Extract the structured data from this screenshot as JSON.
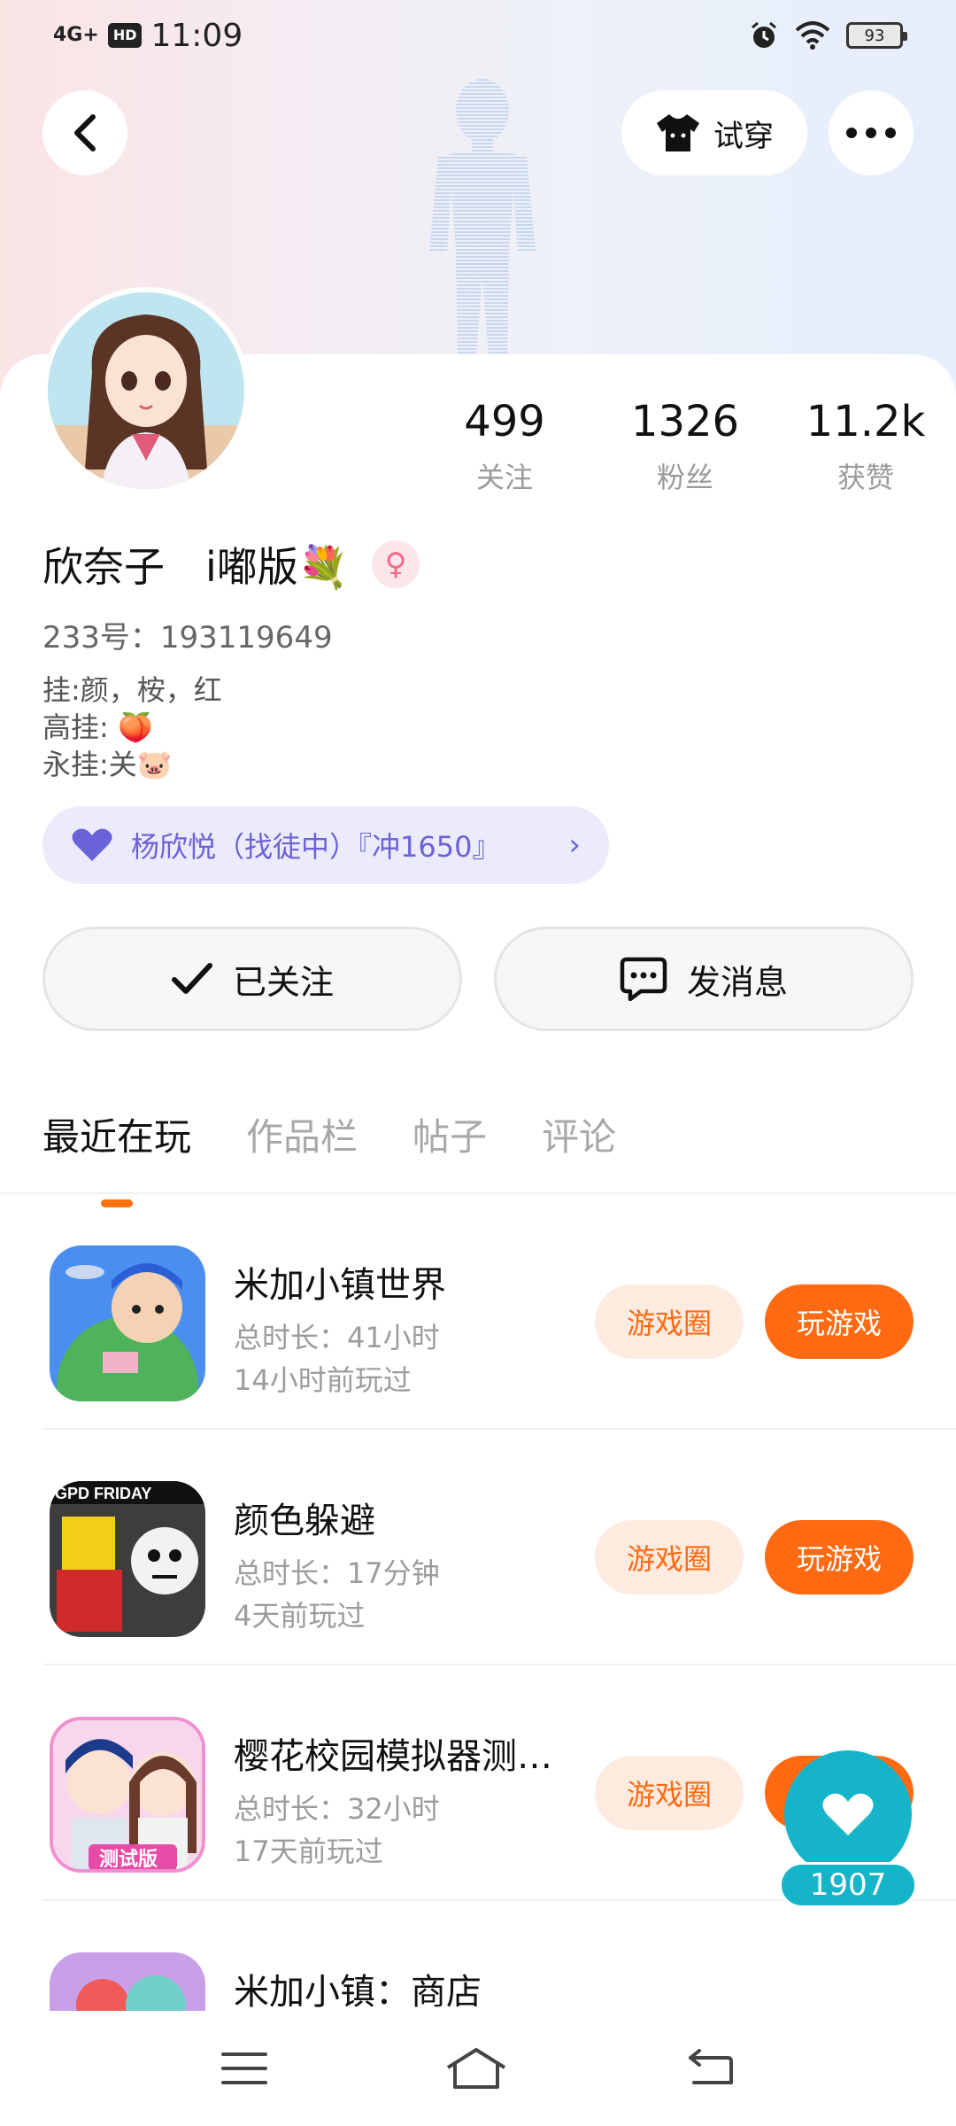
{
  "status_bar": {
    "network": "4G+",
    "hd": "HD",
    "time": "11:09",
    "battery": "93"
  },
  "header": {
    "try_on_label": "试穿"
  },
  "profile": {
    "stats": [
      {
        "value": "499",
        "label": "关注"
      },
      {
        "value": "1326",
        "label": "粉丝"
      },
      {
        "value": "11.2k",
        "label": "获赞"
      }
    ],
    "name": "欣奈子　i嘟版💐",
    "gender_symbol": "♀",
    "uid": "233号：193119649",
    "bio_lines": [
      "挂:颜，桉，红",
      "高挂: 🍑",
      "永挂:关🐷"
    ],
    "guild_text": "杨欣悦（找徒中）『冲1650』",
    "follow_label": "已关注",
    "message_label": "发消息"
  },
  "tabs": [
    {
      "label": "最近在玩",
      "active": true
    },
    {
      "label": "作品栏",
      "active": false
    },
    {
      "label": "帖子",
      "active": false
    },
    {
      "label": "评论",
      "active": false
    }
  ],
  "games": [
    {
      "title": "米加小镇世界",
      "duration": "总时长：41小时",
      "last_played": "14小时前玩过",
      "circle_label": "游戏圈",
      "play_label": "玩游戏"
    },
    {
      "title": "颜色躲避",
      "duration": "总时长：17分钟",
      "last_played": "4天前玩过",
      "circle_label": "游戏圈",
      "play_label": "玩游戏",
      "icon_text": "GPD FRIDAY"
    },
    {
      "title": "樱花校园模拟器测…",
      "duration": "总时长：32小时",
      "last_played": "17天前玩过",
      "circle_label": "游戏圈",
      "play_label": "玩游戏",
      "icon_text": "测试版"
    },
    {
      "title": "米加小镇：商店",
      "duration": "",
      "last_played": "",
      "circle_label": "",
      "play_label": ""
    }
  ],
  "like_float": {
    "count": "1907"
  },
  "colors": {
    "accent": "#ff6a12",
    "accent_soft": "#fdebe0",
    "like": "#15b4c8",
    "guild_bg": "#ecebfb",
    "guild_text": "#6a62d8"
  }
}
